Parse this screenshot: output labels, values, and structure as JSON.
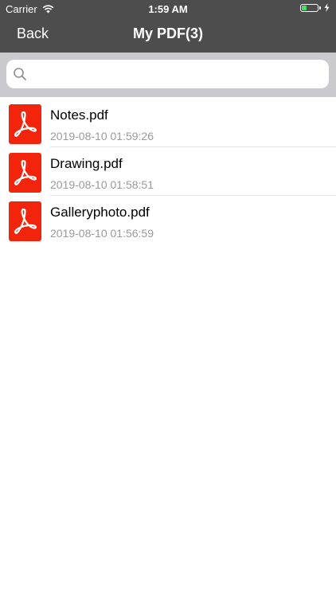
{
  "status_bar": {
    "carrier": "Carrier",
    "time": "1:59 AM",
    "battery_level": 0.3
  },
  "nav": {
    "back_label": "Back",
    "title": "My PDF(3)"
  },
  "search": {
    "value": "",
    "placeholder": ""
  },
  "files": [
    {
      "name": "Notes.pdf",
      "date": "2019-08-10 01:59:26"
    },
    {
      "name": "Drawing.pdf",
      "date": "2019-08-10 01:58:51"
    },
    {
      "name": "Galleryphoto.pdf",
      "date": "2019-08-10 01:56:59"
    }
  ],
  "colors": {
    "header_bg": "#4d4d4d",
    "pdf_icon_red": "#f2240b",
    "battery_green": "#4cd964",
    "search_area_bg": "#c9c9ce",
    "date_gray": "#9a9a9a"
  },
  "icons": {
    "wifi": "wifi-icon",
    "battery": "battery-icon",
    "charging": "lightning-bolt-icon",
    "search": "magnifier-icon",
    "file": "pdf-acrobat-icon"
  }
}
